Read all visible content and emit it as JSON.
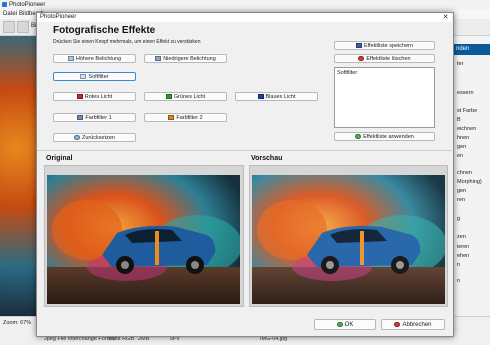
{
  "app": {
    "title": "PhotoPioneer",
    "menu": [
      "Datei",
      "Bildbearb",
      "Bi"
    ],
    "zoom": "Zoom: 67%",
    "right_panel": {
      "header": "nden",
      "items": [
        "ter",
        "essern",
        "st Farbe",
        "B",
        "eichnen",
        "hnen",
        "gen",
        "en",
        "chnen",
        "Morphing)",
        "gen",
        "ren",
        "",
        "g",
        "",
        "zen",
        "ieren",
        "ehen",
        "n",
        "n"
      ]
    },
    "status": {
      "format": "Jpeg File Interchange Format",
      "color": "16Bit RGB",
      "size": "2MB",
      "extra": "0Px",
      "filename": "IMG-04.jpg"
    }
  },
  "dialog": {
    "title": "PhotoPioneer",
    "close_glyph": "✕",
    "heading": "Fotografische Effekte",
    "subtext": "Drücken Sie einen Knopf mehrmals, um einen Effekt zu verstärken",
    "buttons": {
      "higher_exposure": "Höhere Belichtung",
      "lower_exposure": "Niedrigere Belichtung",
      "soft_filter": "Softfilter",
      "red_light": "Rotes Licht",
      "green_light": "Grünes Licht",
      "blue_light": "Blaues Licht",
      "color_filter_1": "Farbfilter 1",
      "color_filter_2": "Farbfilter 2",
      "reset": "Zurücksetzen",
      "save_list": "Effektliste speichern",
      "delete_list": "Effektliste löschen",
      "apply_list": "Effektliste anwenden",
      "ok": "OK",
      "cancel": "Abbrechen"
    },
    "effect_list": [
      "Softfilter"
    ],
    "original_label": "Original",
    "preview_label": "Vorschau"
  },
  "colors": {
    "red": "#c62828",
    "green": "#2e9d34",
    "blue": "#1f3fa8",
    "accent": "#0b5a9c"
  }
}
